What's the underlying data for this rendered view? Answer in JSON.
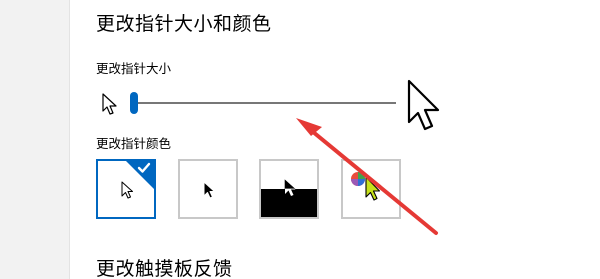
{
  "pointer_section": {
    "title": "更改指针大小和颜色",
    "size_label": "更改指针大小",
    "size_value_percent": 0,
    "color_label": "更改指针颜色",
    "color_options": [
      {
        "name": "white",
        "selected": true
      },
      {
        "name": "black",
        "selected": false
      },
      {
        "name": "inverted",
        "selected": false
      },
      {
        "name": "custom",
        "selected": false
      }
    ]
  },
  "touchpad_section": {
    "title": "更改触摸板反馈"
  },
  "colors": {
    "accent": "#0067c0",
    "annotation_arrow": "#e53935",
    "custom_cursor": "#c6e11b"
  }
}
